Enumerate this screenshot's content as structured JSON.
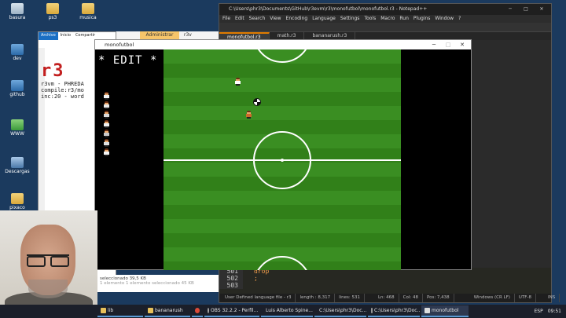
{
  "desktop_icons": [
    {
      "label": "basura",
      "kind": "bin"
    },
    {
      "label": "ps3",
      "kind": "folder"
    },
    {
      "label": "musica",
      "kind": "folder"
    },
    {
      "label": "dev",
      "kind": "doc"
    },
    {
      "label": "github",
      "kind": "doc"
    },
    {
      "label": "WWW",
      "kind": "green"
    },
    {
      "label": "Descargas",
      "kind": "pc"
    },
    {
      "label": "pixaco",
      "kind": "folder"
    }
  ],
  "explorer": {
    "title": "monofutbol",
    "tabs": [
      "Archivo",
      "Inicio",
      "Compartir"
    ],
    "status": "seleccionado  39,5 KB",
    "status2": "1 elemento  1 elemento seleccionado  45 KB"
  },
  "admin_bar": {
    "label": "Administrar",
    "extra": "r3v"
  },
  "terminal_text": {
    "logo": "r3",
    "line1": "r3vm - PHREDA",
    "line2": "compile:r3/mo",
    "line3": "inc:20 - word"
  },
  "notepad": {
    "title": "C:\\Users\\phr3\\Documents\\GitHub\\r3evm\\r3\\monofutbol\\monofutbol.r3 - Notepad++",
    "menu": [
      "File",
      "Edit",
      "Search",
      "View",
      "Encoding",
      "Language",
      "Settings",
      "Tools",
      "Macro",
      "Run",
      "Plugins",
      "Window",
      "?"
    ],
    "tabs": [
      "monofutbol.r3",
      "math.r3",
      "bananarush.r3"
    ],
    "active_tab": 0,
    "code_lines": [
      {
        "num": "501",
        "text": "drop"
      },
      {
        "num": "502",
        "text": ";"
      },
      {
        "num": "503",
        "text": ""
      }
    ],
    "status": {
      "language": "User Defined language file - r3",
      "length": "length : 8,317",
      "lines": "lines: 531",
      "ln": "Ln: 468",
      "col": "Col: 48",
      "pos": "Pos: 7,438",
      "eol": "Windows (CR LF)",
      "encoding": "UTF-8",
      "mode": "INS"
    }
  },
  "game": {
    "title": "monofutbol",
    "mode_label": "* EDIT *",
    "players_in_list": 7
  },
  "taskbar": {
    "items": [
      "lib",
      "bananarush",
      "OBS 32.2.2 - Perfil...",
      "Luis Alberto Spine...",
      "C:\\Users\\phr3\\Doc...",
      "C:\\Users\\phr3\\Doc...",
      "monofutbol"
    ],
    "tray_lang": "ESP",
    "clock": "09:51"
  }
}
